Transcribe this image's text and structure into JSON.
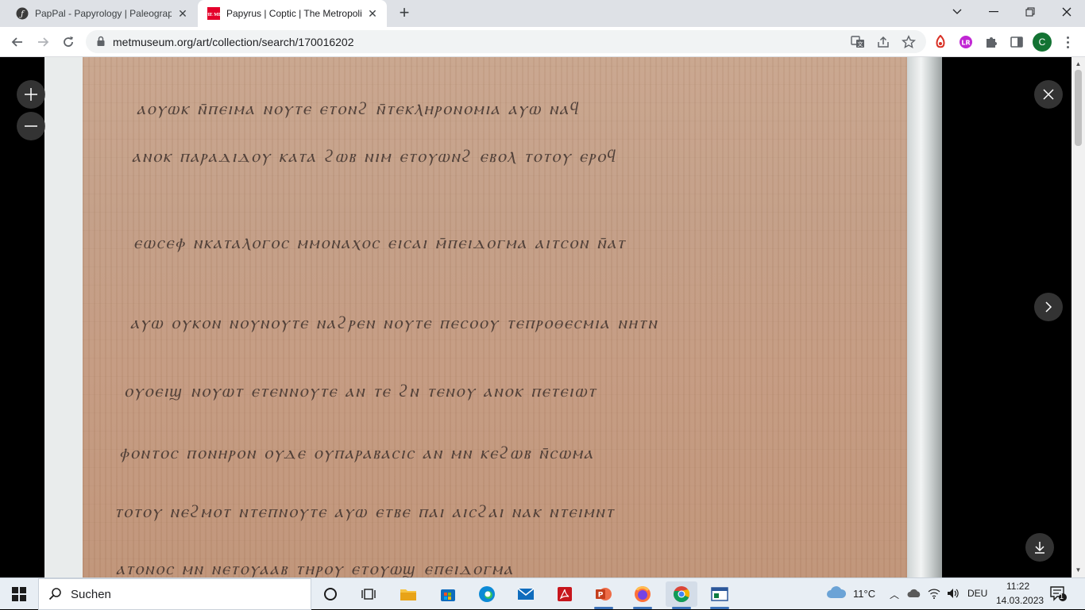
{
  "tabs": [
    {
      "title": "PapPal - Papyrology | Paleograph",
      "favicon": "pappal-icon",
      "active": false
    },
    {
      "title": "Papyrus | Coptic | The Metropolit",
      "favicon": "met-icon",
      "active": true
    }
  ],
  "address_bar": {
    "url": "metmuseum.org/art/collection/search/170016202"
  },
  "viewer": {
    "script_lines": [
      "ⲁⲟⲩⲱⲕ ⲛ̄ⲡⲉⲓⲙⲁ ⲛⲟⲩⲧⲉ ⲉⲧⲟⲛϩ ⲛ̄ⲧⲉⲕⲗⲏⲣⲟⲛⲟⲙⲓⲁ ⲁⲩⲱ ⲛⲁϥ",
      "ⲁⲛⲟⲕ ⲡⲁⲣⲁⲇⲓⲇⲟⲩ ⲕⲁⲧⲁ ϩⲱⲃ ⲛⲓⲙ ⲉⲧⲟⲩⲱⲛϩ ⲉⲃⲟⲗ ⲧⲟⲧⲟⲩ ⲉⲣⲟϥ",
      "ⲉⲱⲥⲉⲫ ⲛⲕⲁⲧⲁⲗⲟⲅⲟⲥ ⲙⲙⲟⲛⲁⲭⲟⲥ ⲉⲓⲥⲁⲓ ⲙ̄ⲡⲉⲓⲇⲟⲅⲙⲁ ⲁⲓⲧⲥⲟⲛ ⲛ̄ⲁⲧ",
      "ⲁⲩⲱ ⲟⲩⲕⲟⲛ ⲛⲟⲩⲛⲟⲩⲧⲉ ⲛⲁϩⲣⲉⲛ ⲛⲟⲩⲧⲉ ⲡⲉⲥⲟⲟⲩ ⲧⲉⲡⲣⲟⲑⲉⲥⲙⲓⲁ ⲛⲏⲧⲛ",
      "ⲟⲩⲟⲉⲓϣ ⲛⲟⲩⲱⲧ ⲉⲧⲉⲛⲛⲟⲩⲧⲉ ⲁⲛ ⲧⲉ ϩⲛ ⲧⲉⲛⲟⲩ ⲁⲛⲟⲕ ⲡⲉⲧⲉⲓⲱⲧ",
      "ⲫⲟⲛⲧⲟⲥ ⲡⲟⲛⲏⲣⲟⲛ ⲟⲩⲇⲉ ⲟⲩⲡⲁⲣⲁⲃⲁⲥⲓⲥ ⲁⲛ ⲙⲛ ⲕⲉϩⲱⲃ ⲛ̄ⲥⲱⲙⲁ",
      "ⲧⲟⲧⲟⲩ ⲛⲉϩⲙⲟⲧ ⲛⲧⲉⲡⲛⲟⲩⲧⲉ ⲁⲩⲱ ⲉⲧⲃⲉ ⲡⲁⲓ ⲁⲓⲥϩⲁⲓ ⲛⲁⲕ ⲛⲧⲉⲓⲙⲛⲧ",
      "ⲁⲧⲟⲛⲟⲥ ⲙⲛ ⲛⲉⲧⲟⲩⲁⲁⲃ ⲧⲏⲣⲟⲩ ⲉⲧⲟⲩⲱϣ ⲉⲡⲉⲓⲇⲟⲅⲙⲁ"
    ]
  },
  "taskbar": {
    "search_label": "Suchen",
    "weather": "11°C",
    "language": "DEU",
    "time": "11:22",
    "date": "14.03.2023",
    "notification_count": "1"
  },
  "colors": {
    "papyrus": "#c49a80",
    "ink": "#3a2e2a",
    "tabstrip": "#dee1e6",
    "profile": "#137333"
  }
}
